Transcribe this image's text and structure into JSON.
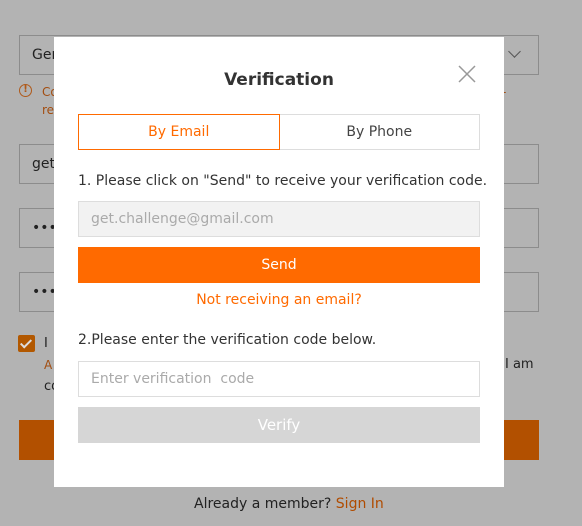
{
  "background": {
    "field_gender": "Ger",
    "info_text_1": "Co",
    "info_text_2": "re",
    "info_tail": "-",
    "field_email": "get.",
    "field_password": "••••",
    "field_confirm": "••••",
    "agree_text_1": "I",
    "agree_text_2": "A",
    "agree_text_3": "co",
    "agree_text_right": "I am",
    "already_member": "Already a member?",
    "sign_in": "Sign In"
  },
  "modal": {
    "title": "Verification",
    "tabs": [
      {
        "label": "By Email",
        "active": true
      },
      {
        "label": "By Phone",
        "active": false
      }
    ],
    "step1": "1. Please click on \"Send\" to receive your verification code.",
    "email_value": "get.challenge@gmail.com",
    "send_label": "Send",
    "resend_link": "Not receiving an email?",
    "step2": "2.Please enter the verification code below.",
    "code_placeholder": "Enter verification  code",
    "verify_label": "Verify"
  },
  "colors": {
    "accent": "#ff6a00",
    "overlay": "#b3b3b3",
    "disabled": "#d6d6d6"
  },
  "icons": {
    "close": "close-icon",
    "info": "info-icon",
    "chevron": "chevron-down-icon",
    "check": "check-icon"
  }
}
